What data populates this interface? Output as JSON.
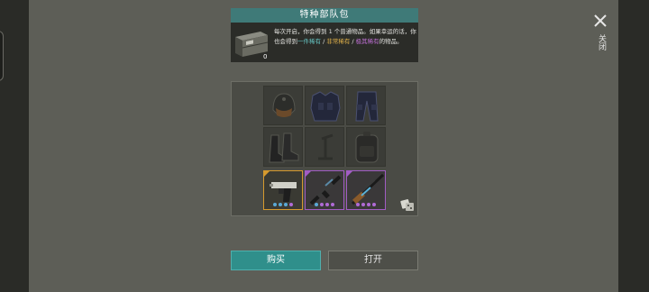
{
  "header": {
    "title": "特种部队包",
    "crate_count": "0",
    "desc_prefix": "每次开启，你会得到 1 个普通物品。如果幸运的话，你也会得到",
    "desc_rare": "一件稀有",
    "desc_sep1": " / ",
    "desc_very_rare": "非常稀有",
    "desc_sep2": " / ",
    "desc_extremely_rare": "极其稀有",
    "desc_suffix": "的物品。"
  },
  "items": [
    {
      "name": "helmet",
      "rarity": "common"
    },
    {
      "name": "armor-vest",
      "rarity": "common"
    },
    {
      "name": "pants",
      "rarity": "common"
    },
    {
      "name": "boots",
      "rarity": "common"
    },
    {
      "name": "gun-stand",
      "rarity": "common"
    },
    {
      "name": "backpack",
      "rarity": "common"
    },
    {
      "name": "pistol",
      "rarity": "very-rare",
      "dots": [
        "#5aa8d6",
        "#5aa8d6",
        "#5aa8d6",
        "#b06ad6"
      ]
    },
    {
      "name": "rifle",
      "rarity": "extremely-rare",
      "dots": [
        "#5aa8d6",
        "#b06ad6",
        "#b06ad6",
        "#b06ad6"
      ]
    },
    {
      "name": "sniper-rifle",
      "rarity": "extremely-rare",
      "dots": [
        "#b06ad6",
        "#b06ad6",
        "#b06ad6",
        "#b06ad6"
      ]
    }
  ],
  "buttons": {
    "buy_label": "购买",
    "open_label": "打开"
  },
  "close": {
    "label": "关闭"
  },
  "colors": {
    "header_bar": "#3f7a78",
    "buy_button": "#2f8f8b",
    "rare": "#66c4c2",
    "very_rare": "#e0b14a",
    "extremely_rare": "#c070d6"
  }
}
